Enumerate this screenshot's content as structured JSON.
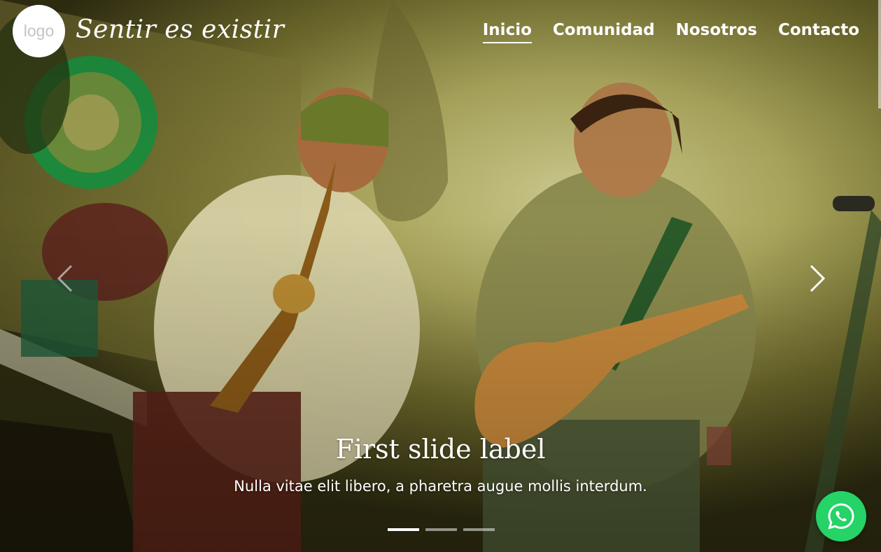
{
  "header": {
    "logo_text": "logo",
    "brand_title": "Sentir es existir"
  },
  "nav": {
    "items": [
      {
        "label": "Inicio",
        "active": true
      },
      {
        "label": "Comunidad",
        "active": false
      },
      {
        "label": "Nosotros",
        "active": false
      },
      {
        "label": "Contacto",
        "active": false
      }
    ]
  },
  "carousel": {
    "slide_title": "First slide label",
    "slide_text": "Nulla vitae elit libero, a pharetra augue mollis interdum.",
    "indicator_count": 3,
    "active_index": 0,
    "prev_icon": "chevron-left-icon",
    "next_icon": "chevron-right-icon"
  },
  "whatsapp": {
    "icon": "whatsapp-icon",
    "color": "#25d366"
  }
}
